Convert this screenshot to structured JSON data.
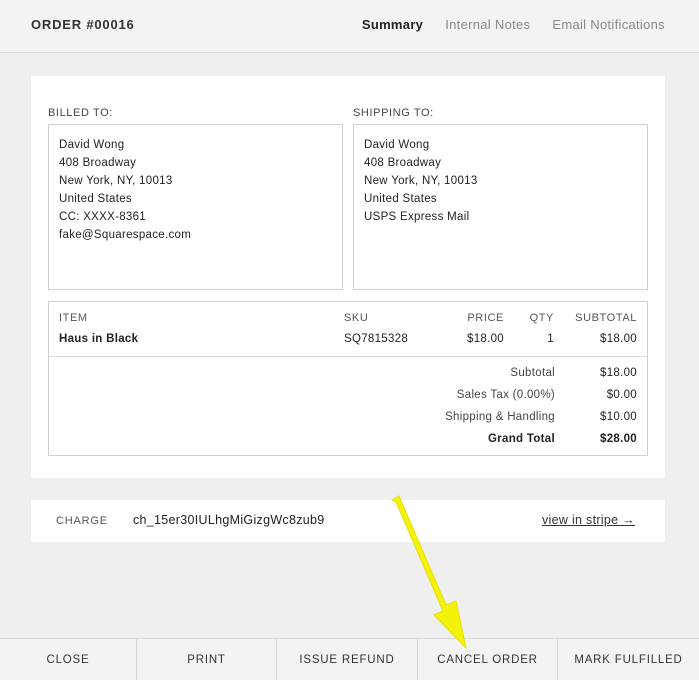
{
  "header": {
    "order_title": "ORDER #00016",
    "tabs": [
      {
        "label": "Summary",
        "active": true
      },
      {
        "label": "Internal Notes",
        "active": false
      },
      {
        "label": "Email Notifications",
        "active": false
      }
    ]
  },
  "billing": {
    "label": "BILLED TO:",
    "lines": [
      "David Wong",
      "408 Broadway",
      "New York, NY, 10013",
      "United States",
      "CC: XXXX-8361",
      "fake@Squarespace.com"
    ]
  },
  "shipping": {
    "label": "SHIPPING TO:",
    "lines": [
      "David Wong",
      "408 Broadway",
      "New York, NY, 10013",
      "United States",
      "USPS Express Mail"
    ]
  },
  "items_table": {
    "columns": [
      "ITEM",
      "SKU",
      "PRICE",
      "QTY",
      "SUBTOTAL"
    ],
    "rows": [
      {
        "item": "Haus in Black",
        "sku": "SQ7815328",
        "price": "$18.00",
        "qty": "1",
        "subtotal": "$18.00"
      }
    ]
  },
  "totals": {
    "subtotal_label": "Subtotal",
    "subtotal_value": "$18.00",
    "tax_label": "Sales Tax (0.00%)",
    "tax_value": "$0.00",
    "shipping_label": "Shipping & Handling",
    "shipping_value": "$10.00",
    "grand_label": "Grand Total",
    "grand_value": "$28.00"
  },
  "charge": {
    "label": "CHARGE",
    "id": "ch_15er30IULhgMiGizgWc8zub9",
    "link": "view in stripe →"
  },
  "footer": {
    "buttons": [
      "CLOSE",
      "PRINT",
      "ISSUE REFUND",
      "CANCEL ORDER",
      "MARK FULFILLED"
    ]
  },
  "colors": {
    "background": "#efefef",
    "card": "#ffffff",
    "annotation_arrow": "#f5f20a"
  }
}
